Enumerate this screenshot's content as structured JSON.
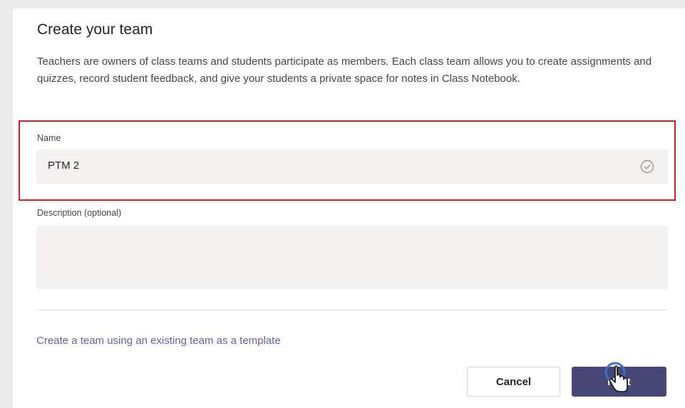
{
  "dialog": {
    "title": "Create your team",
    "description": "Teachers are owners of class teams and students participate as members. Each class team allows you to create assignments and quizzes, record student feedback, and give your students a private space for notes in Class Notebook."
  },
  "name_field": {
    "label": "Name",
    "value": "PTM 2",
    "status_icon": "check-circle-icon"
  },
  "description_field": {
    "label": "Description (optional)",
    "value": ""
  },
  "template_link": "Create a team using an existing team as a template",
  "buttons": {
    "cancel": "Cancel",
    "next": "Next"
  },
  "colors": {
    "accent": "#6264a7",
    "primary_button": "#464775",
    "highlight_border": "#e3191a"
  }
}
